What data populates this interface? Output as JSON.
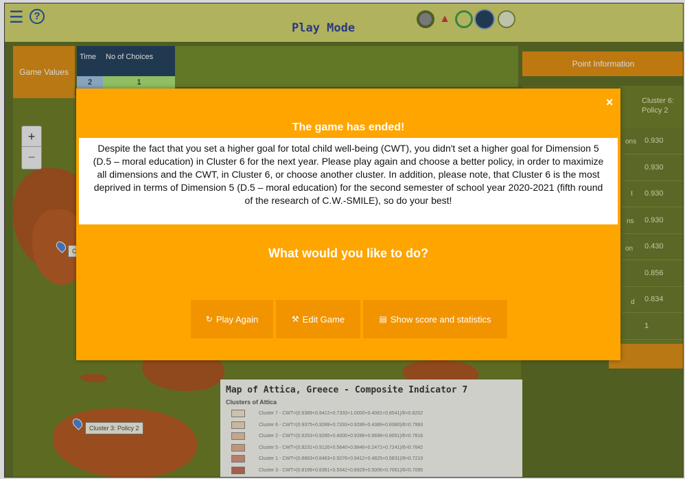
{
  "topbar": {
    "title": "Play Mode",
    "logo_glyph": "☰",
    "help_glyph": "?",
    "icons": [
      "circle-badge-icon",
      "person-pin-icon",
      "ring-icon",
      "avatar-icon",
      "list-icon"
    ]
  },
  "game_values": {
    "label": "Game Values",
    "headers": [
      "Time",
      "No of Choices"
    ],
    "values": [
      "2",
      "1"
    ]
  },
  "point_info": {
    "label": "Point Information",
    "column_header": "Cluster 6: Policy 2",
    "values": [
      "0.930",
      "0.930",
      "0.930",
      "0.930",
      "0.430",
      "0.856",
      "0.834",
      "1"
    ],
    "side_fragments": [
      "ons",
      "t",
      "ns",
      "on",
      "d"
    ]
  },
  "map": {
    "zoom_in": "+",
    "zoom_out": "−",
    "title": "Map of Attica, Greece - Composite Indicator 7",
    "legend_title": "Clusters of Attica",
    "legend": [
      {
        "text": "Cluster 7 - CWT=(0.9389+0.9412+0.7333+1.0000+0.4081+0.8541)/6=0.8202",
        "color": "#f0e4cc"
      },
      {
        "text": "Cluster 6 - CWT=(0.9375+0.9289+0.7333+0.9286+0.4389+0.8380)/6=0.7993",
        "color": "#eed6b4"
      },
      {
        "text": "Cluster 2 - CWT=(0.9253+0.9285+0.4000+0.9286+0.6696+0.8051)/6=0.7816",
        "color": "#e8c4a0"
      },
      {
        "text": "Cluster 5 - CWT=(0.9231+0.9120+0.5640+0.9846+0.2471+0.7241)/6=0.7642",
        "color": "#e3ae8c"
      },
      {
        "text": "Cluster 1 - CWT=(0.8863+0.8463+0.5076+0.9412+0.4825+0.5831)/6=0.7219",
        "color": "#d8907a"
      },
      {
        "text": "Cluster 3 - CWT=(0.8199+0.8361+0.5042+0.8929+0.5006+0.7061)/6=0.7095",
        "color": "#c26a55"
      }
    ],
    "marker_labels": [
      "Cluster 3: Policy 2",
      "Cl"
    ]
  },
  "modal": {
    "title": "The game has ended!",
    "close_glyph": "×",
    "message": "Despite the fact that you set a higher goal for total child well-being (CWT), you didn't set a higher goal for Dimension 5 (D.5 – moral education) in Cluster 6 for the next year. Please play again and choose a better policy, in order to maximize all dimensions and the CWT, in Cluster 6, or choose another cluster. In addition, please note, that Cluster 6 is the most deprived in terms of Dimension 5 (D.5 – moral education) for the second semester of school year 2020-2021 (fifth round of the research of C.W.-SMILE), so do your best!",
    "question": "What would you like to do?",
    "buttons": [
      {
        "label": "Play Again",
        "icon": "↻"
      },
      {
        "label": "Edit Game",
        "icon": "⚒"
      },
      {
        "label": "Show score and statistics",
        "icon": "▤"
      }
    ]
  },
  "colors": {
    "modal_bg": "#ffa500",
    "button_bg": "#f29400",
    "title_blue": "#2b3e96",
    "topbar_bg": "#cfd16a"
  }
}
